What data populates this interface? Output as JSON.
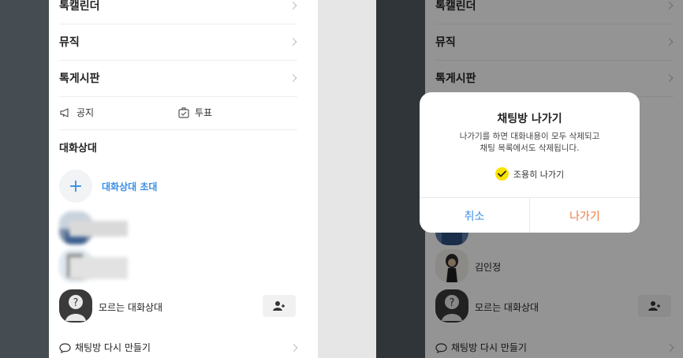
{
  "left": {
    "menu": [
      "톡캘린더",
      "뮤직",
      "톡게시판"
    ],
    "notice": "공지",
    "vote": "투표",
    "section_title": "대화상대",
    "invite_label": "대화상대 초대",
    "members": [
      {
        "name": "",
        "redacted": true
      },
      {
        "name": "",
        "redacted": true
      },
      {
        "name": "모르는 대화상대",
        "redacted": false
      }
    ],
    "recreate_label": "채팅방 다시 만들기"
  },
  "right": {
    "menu": [
      "톡캘린더",
      "뮤직",
      "톡게시판"
    ],
    "visible_member": "김인정",
    "unknown_member": "모르는 대화상대",
    "recreate_label": "채팅방 다시 만들기",
    "dialog": {
      "title": "채팅방 나가기",
      "message_line1": "나가기를 하면 대화내용이 모두 삭제되고",
      "message_line2": "채팅 목록에서도 삭제됩니다.",
      "quiet_label": "조용히 나가기",
      "quiet_checked": true,
      "cancel": "취소",
      "leave": "나가기"
    }
  },
  "colors": {
    "accent_blue": "#3a8ee6",
    "leave_orange": "#f07a3c",
    "check_yellow": "#fbe300"
  }
}
